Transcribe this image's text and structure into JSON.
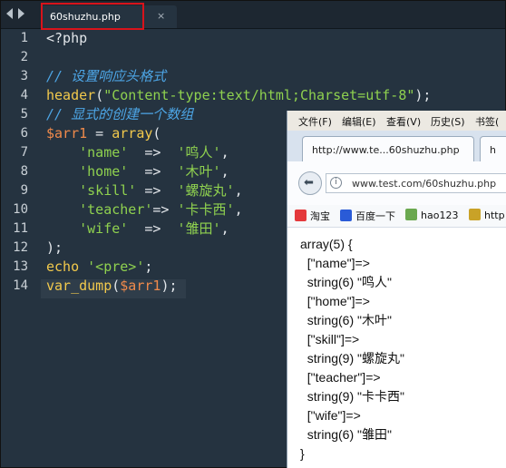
{
  "editor": {
    "tab_title": "60shuzhu.php",
    "tab_close": "×",
    "line_numbers": [
      "1",
      "2",
      "3",
      "4",
      "5",
      "6",
      "7",
      "8",
      "9",
      "10",
      "11",
      "12",
      "13",
      "14"
    ],
    "lines": [
      [
        {
          "t": "<?php",
          "c": "op"
        }
      ],
      [],
      [
        {
          "t": "// 设置响应头格式",
          "c": "comment"
        }
      ],
      [
        {
          "t": "header",
          "c": "fn"
        },
        {
          "t": "(",
          "c": "op"
        },
        {
          "t": "\"Content-type:text/html;Charset=utf-8\"",
          "c": "str"
        },
        {
          "t": ");",
          "c": "op"
        }
      ],
      [
        {
          "t": "// 显式的创建一个数组",
          "c": "comment"
        }
      ],
      [
        {
          "t": "$arr1",
          "c": "var"
        },
        {
          "t": " = ",
          "c": "op"
        },
        {
          "t": "array",
          "c": "fn"
        },
        {
          "t": "(",
          "c": "op"
        }
      ],
      [
        {
          "t": "    'name'",
          "c": "str"
        },
        {
          "t": "  =>  ",
          "c": "op"
        },
        {
          "t": "'鸣人'",
          "c": "str"
        },
        {
          "t": ",",
          "c": "op"
        }
      ],
      [
        {
          "t": "    'home'",
          "c": "str"
        },
        {
          "t": "  =>  ",
          "c": "op"
        },
        {
          "t": "'木叶'",
          "c": "str"
        },
        {
          "t": ",",
          "c": "op"
        }
      ],
      [
        {
          "t": "    'skill'",
          "c": "str"
        },
        {
          "t": " =>  ",
          "c": "op"
        },
        {
          "t": "'螺旋丸'",
          "c": "str"
        },
        {
          "t": ",",
          "c": "op"
        }
      ],
      [
        {
          "t": "    'teacher'",
          "c": "str"
        },
        {
          "t": "=> ",
          "c": "op"
        },
        {
          "t": "'卡卡西'",
          "c": "str"
        },
        {
          "t": ",",
          "c": "op"
        }
      ],
      [
        {
          "t": "    'wife'",
          "c": "str"
        },
        {
          "t": "  =>  ",
          "c": "op"
        },
        {
          "t": "'雏田'",
          "c": "str"
        },
        {
          "t": ",",
          "c": "op"
        }
      ],
      [
        {
          "t": ");",
          "c": "op"
        }
      ],
      [
        {
          "t": "echo",
          "c": "kw"
        },
        {
          "t": " ",
          "c": "op"
        },
        {
          "t": "'<pre>'",
          "c": "str"
        },
        {
          "t": ";",
          "c": "op"
        }
      ],
      [
        {
          "t": "var_dump",
          "c": "fn"
        },
        {
          "t": "(",
          "c": "op"
        },
        {
          "t": "$arr1",
          "c": "var"
        },
        {
          "t": ");",
          "c": "op"
        }
      ]
    ]
  },
  "browser": {
    "menu": [
      "文件(F)",
      "编辑(E)",
      "查看(V)",
      "历史(S)",
      "书签("
    ],
    "tabs": [
      "http://www.te...60shuzhu.php",
      "h"
    ],
    "url": "www.test.com/60shuzhu.php",
    "bookmarks": [
      "淘宝",
      "百度一下",
      "hao123",
      "http"
    ],
    "output": [
      "array(5) {",
      "  [\"name\"]=>",
      "  string(6) \"鸣人\"",
      "  [\"home\"]=>",
      "  string(6) \"木叶\"",
      "  [\"skill\"]=>",
      "  string(9) \"螺旋丸\"",
      "  [\"teacher\"]=>",
      "  string(9) \"卡卡西\"",
      "  [\"wife\"]=>",
      "  string(6) \"雏田\"",
      "}"
    ]
  },
  "colors": {
    "editor_bg": "#253340",
    "comment": "#4da6e6",
    "string": "#8fd14f",
    "variable": "#f08a4b",
    "function": "#f2c94c",
    "tab_highlight": "#d8131b"
  }
}
